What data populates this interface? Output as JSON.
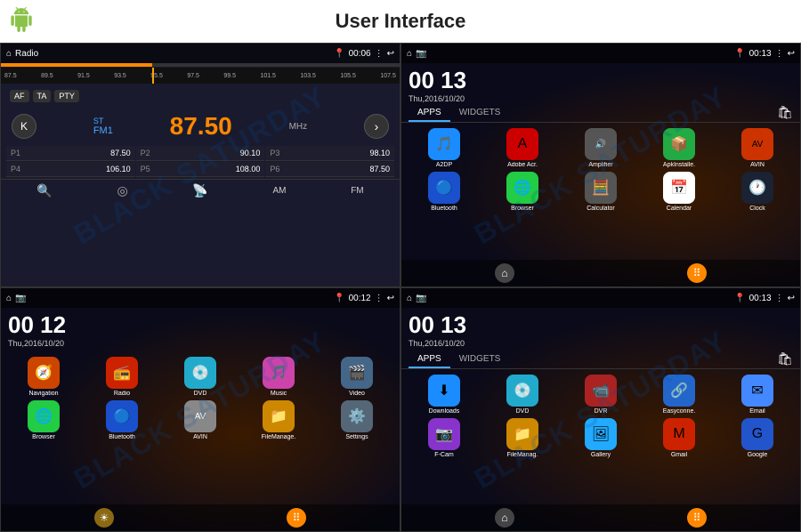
{
  "header": {
    "title": "User Interface"
  },
  "screens": {
    "radio": {
      "title": "Radio",
      "time": "00:06",
      "st_label": "ST",
      "fm_label": "FM1",
      "frequency": "87.50",
      "mhz": "MHz",
      "freq_scale": [
        "87.5",
        "89.5",
        "91.5",
        "93.5",
        "95.5",
        "97.5",
        "99.5",
        "101.5",
        "103.5",
        "105.5",
        "107.5"
      ],
      "presets": [
        {
          "num": "P1",
          "freq": "87.50"
        },
        {
          "num": "P2",
          "freq": "90.10"
        },
        {
          "num": "P3",
          "freq": "98.10"
        },
        {
          "num": "P4",
          "freq": "106.10"
        },
        {
          "num": "P5",
          "freq": "108.00"
        },
        {
          "num": "P6",
          "freq": "87.50"
        }
      ],
      "buttons": [
        "AF",
        "TA",
        "PTY"
      ],
      "bottom_labels": [
        "AM",
        "FM"
      ]
    },
    "apps_top": {
      "time": "00 13",
      "date": "Thu,2016/10/20",
      "tabs": [
        "APPS",
        "WIDGETS"
      ],
      "active_tab": "APPS",
      "row1": [
        {
          "label": "A2DP",
          "icon": "a2dp"
        },
        {
          "label": "Adobe Acr.",
          "icon": "adobe"
        },
        {
          "label": "Amplifier",
          "icon": "amplifier"
        },
        {
          "label": "ApkInstalle.",
          "icon": "apkinstaller"
        },
        {
          "label": "AVIN",
          "icon": "avin"
        }
      ],
      "row2": [
        {
          "label": "Bluetooth",
          "icon": "bluetooth"
        },
        {
          "label": "Browser",
          "icon": "browser"
        },
        {
          "label": "Calculator",
          "icon": "calculator"
        },
        {
          "label": "Calendar",
          "icon": "calendar"
        },
        {
          "label": "Clock",
          "icon": "clock"
        }
      ]
    },
    "home": {
      "time": "00 12",
      "date": "Thu,2016/10/20",
      "apps": [
        {
          "label": "Navigation",
          "icon": "navigation"
        },
        {
          "label": "Radio",
          "icon": "radio2"
        },
        {
          "label": "DVD",
          "icon": "dvd"
        },
        {
          "label": "Music",
          "icon": "music"
        },
        {
          "label": "Video",
          "icon": "video"
        }
      ],
      "apps2": [
        {
          "label": "Browser",
          "icon": "browser2"
        },
        {
          "label": "Bluetooth",
          "icon": "bluetooth2"
        },
        {
          "label": "AVIN",
          "icon": "avin2"
        },
        {
          "label": "FileManage.",
          "icon": "filemanager"
        },
        {
          "label": "Settings",
          "icon": "settings"
        }
      ]
    },
    "apps_bottom": {
      "time": "00 13",
      "date": "Thu,2016/10/20",
      "tabs": [
        "APPS",
        "WIDGETS"
      ],
      "active_tab": "APPS",
      "row1": [
        {
          "label": "Downloads",
          "icon": "downloads"
        },
        {
          "label": "DVD",
          "icon": "dvd2"
        },
        {
          "label": "DVR",
          "icon": "dvr"
        },
        {
          "label": "Easyconne.",
          "icon": "easyconn"
        },
        {
          "label": "Email",
          "icon": "email"
        }
      ],
      "row2": [
        {
          "label": "F-Cam",
          "icon": "fcam"
        },
        {
          "label": "FileManag.",
          "icon": "filemanag2"
        },
        {
          "label": "Gallery",
          "icon": "gallery"
        },
        {
          "label": "Gmail",
          "icon": "gmail"
        },
        {
          "label": "Google",
          "icon": "google"
        }
      ]
    }
  },
  "watermarks": [
    "BLACK SATURDAY",
    "BLACK SATURDAY",
    "BLACK SATURDAY",
    "BLACK SATURDAY"
  ]
}
